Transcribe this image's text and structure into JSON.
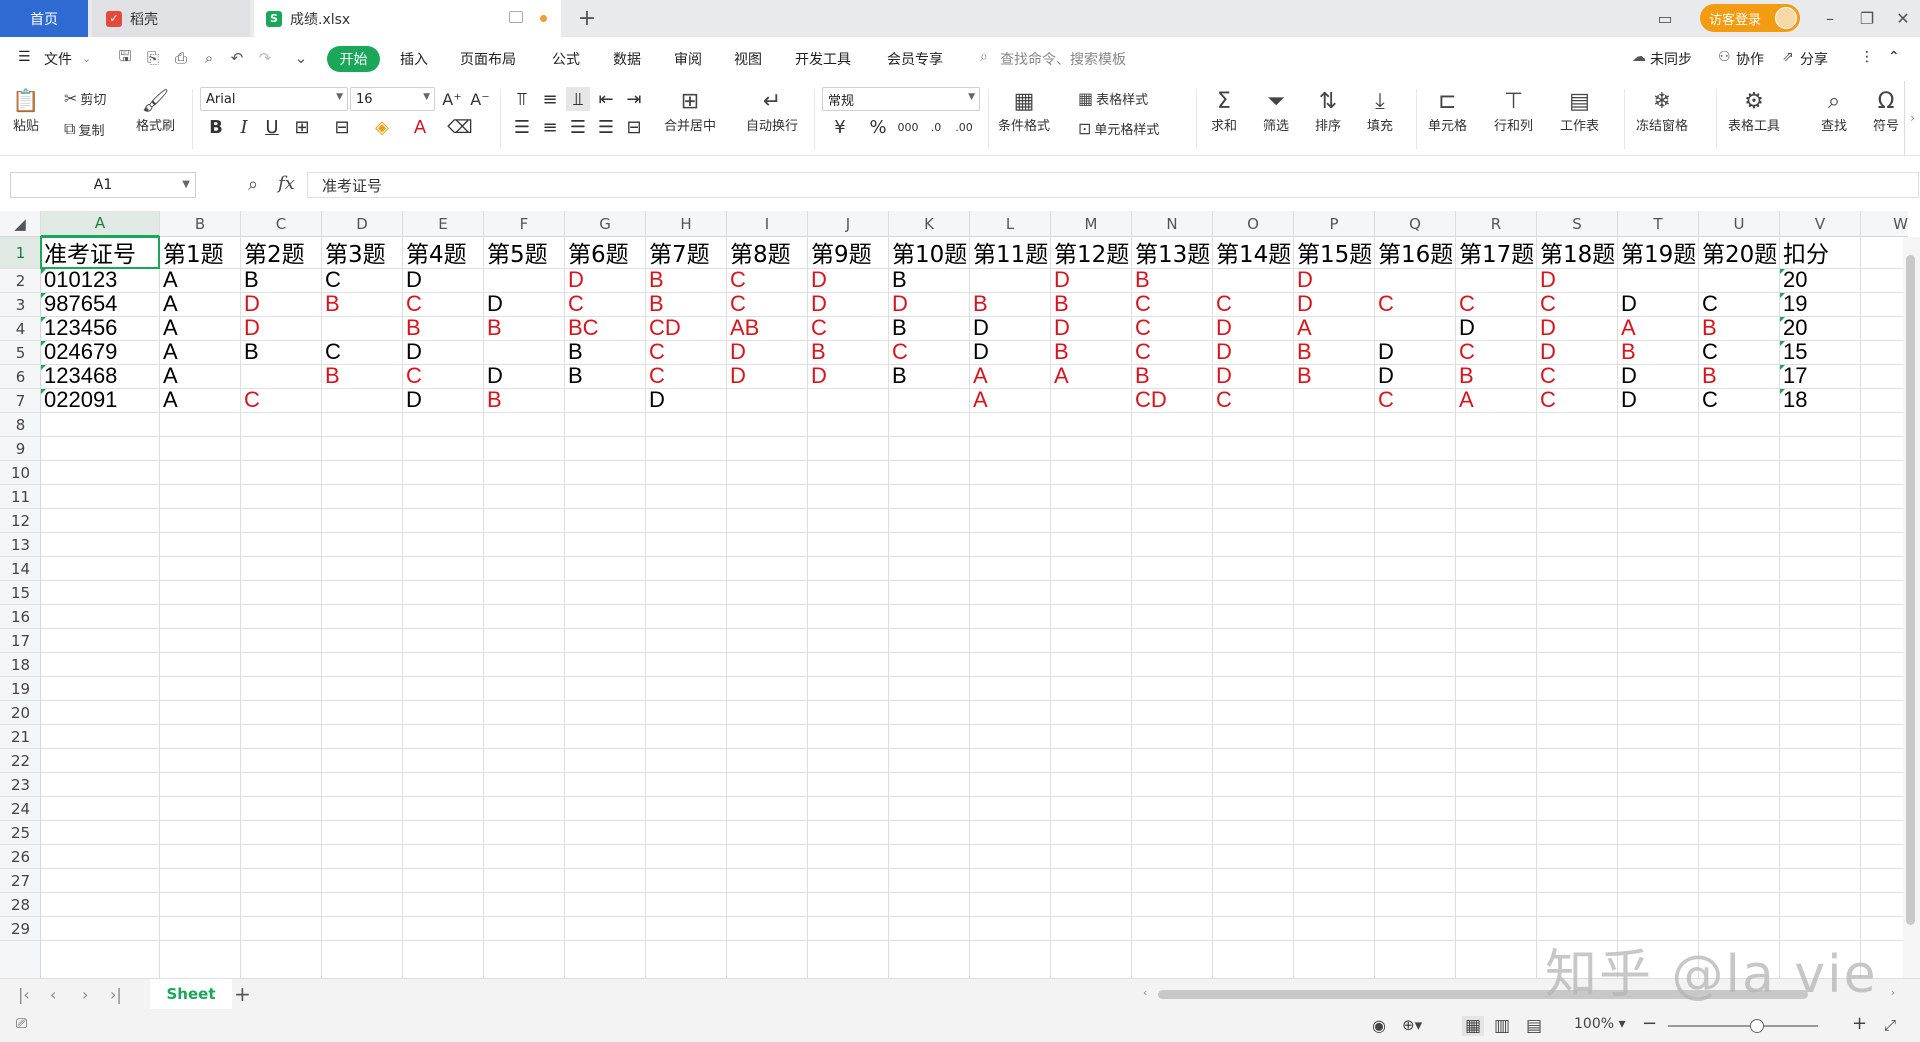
{
  "titlebar": {
    "home_tab": "首页",
    "dao_tab": "稻壳",
    "file_tab": "成绩.xlsx",
    "add_tab": "+",
    "visitor_login": "访客登录"
  },
  "menubar": {
    "file": "文件",
    "items": [
      "开始",
      "插入",
      "页面布局",
      "公式",
      "数据",
      "审阅",
      "视图",
      "开发工具",
      "会员专享"
    ],
    "search_placeholder": "查找命令、搜索模板",
    "unsynced": "未同步",
    "collaborate": "协作",
    "share": "分享"
  },
  "ribbon": {
    "paste": "粘贴",
    "cut": "剪切",
    "copy": "复制",
    "format_painter": "格式刷",
    "font_name": "Arial",
    "font_size": "16",
    "merge_center": "合并居中",
    "wrap_text": "自动换行",
    "number_format": "常规",
    "conditional_format": "条件格式",
    "table_style": "表格样式",
    "cell_style": "单元格样式",
    "sum": "求和",
    "filter": "筛选",
    "sort": "排序",
    "fill": "填充",
    "cell": "单元格",
    "row_col": "行和列",
    "worksheet": "工作表",
    "freeze": "冻结窗格",
    "table_tools": "表格工具",
    "find": "查找",
    "symbol": "符号"
  },
  "formulabar": {
    "namebox": "A1",
    "fx": "fx",
    "content": "准考证号"
  },
  "sheet": {
    "columns": [
      "A",
      "B",
      "C",
      "D",
      "E",
      "F",
      "G",
      "H",
      "I",
      "J",
      "K",
      "L",
      "M",
      "N",
      "O",
      "P",
      "Q",
      "R",
      "S",
      "T",
      "U",
      "V",
      "W"
    ],
    "rows": [
      "1",
      "2",
      "3",
      "4",
      "5",
      "6",
      "7",
      "8",
      "9",
      "10",
      "11",
      "12",
      "13",
      "14",
      "15",
      "16",
      "17",
      "18",
      "19",
      "20",
      "21",
      "22",
      "23",
      "24",
      "25",
      "26",
      "27",
      "28",
      "29"
    ],
    "header_row": [
      "准考证号",
      "第1题",
      "第2题",
      "第3题",
      "第4题",
      "第5题",
      "第6题",
      "第7题",
      "第8题",
      "第9题",
      "第10题",
      "第11题",
      "第12题",
      "第13题",
      "第14题",
      "第15题",
      "第16题",
      "第17题",
      "第18题",
      "第19题",
      "第20题",
      "扣分"
    ],
    "data": [
      {
        "id": "010123",
        "answers": [
          "A",
          "B",
          "C",
          "D",
          "",
          "D",
          "B",
          "C",
          "D",
          "B",
          "",
          "D",
          "B",
          "",
          "D",
          "",
          "",
          "D",
          "",
          "",
          ""
        ],
        "red": [
          false,
          false,
          false,
          false,
          false,
          true,
          true,
          true,
          true,
          false,
          false,
          true,
          true,
          false,
          true,
          false,
          false,
          true,
          false,
          false,
          false
        ],
        "score": "20"
      },
      {
        "id": "987654",
        "answers": [
          "A",
          "D",
          "B",
          "C",
          "D",
          "C",
          "B",
          "C",
          "D",
          "D",
          "B",
          "B",
          "C",
          "C",
          "D",
          "C",
          "C",
          "C",
          "D",
          "C",
          ""
        ],
        "red": [
          false,
          true,
          true,
          true,
          false,
          true,
          true,
          true,
          true,
          true,
          true,
          true,
          true,
          true,
          true,
          true,
          true,
          true,
          false,
          false,
          false
        ],
        "score": "19"
      },
      {
        "id": "123456",
        "answers": [
          "A",
          "D",
          "",
          "B",
          "B",
          "BC",
          "CD",
          "AB",
          "C",
          "B",
          "D",
          "D",
          "C",
          "D",
          "A",
          "",
          "D",
          "D",
          "A",
          "B",
          ""
        ],
        "red": [
          false,
          true,
          false,
          true,
          true,
          true,
          true,
          true,
          true,
          false,
          false,
          true,
          true,
          true,
          true,
          false,
          false,
          true,
          true,
          true,
          false
        ],
        "score": "20"
      },
      {
        "id": "024679",
        "answers": [
          "A",
          "B",
          "C",
          "D",
          "",
          "B",
          "C",
          "D",
          "B",
          "C",
          "D",
          "B",
          "C",
          "D",
          "B",
          "D",
          "C",
          "D",
          "B",
          "C",
          ""
        ],
        "red": [
          false,
          false,
          false,
          false,
          false,
          false,
          true,
          true,
          true,
          true,
          false,
          true,
          true,
          true,
          true,
          false,
          true,
          true,
          true,
          false,
          false
        ],
        "score": "15"
      },
      {
        "id": "123468",
        "answers": [
          "A",
          "",
          "B",
          "C",
          "D",
          "B",
          "C",
          "D",
          "D",
          "B",
          "A",
          "A",
          "B",
          "D",
          "B",
          "D",
          "B",
          "C",
          "D",
          "B",
          ""
        ],
        "red": [
          false,
          false,
          true,
          true,
          false,
          false,
          true,
          true,
          true,
          false,
          true,
          true,
          true,
          true,
          true,
          false,
          true,
          true,
          false,
          true,
          false
        ],
        "score": "17"
      },
      {
        "id": "022091",
        "answers": [
          "A",
          "C",
          "",
          "D",
          "B",
          "",
          "D",
          "",
          "",
          "",
          "A",
          "",
          "CD",
          "C",
          "",
          "C",
          "A",
          "C",
          "D",
          "C",
          ""
        ],
        "red": [
          false,
          true,
          false,
          false,
          true,
          false,
          false,
          false,
          false,
          false,
          true,
          false,
          true,
          true,
          false,
          true,
          true,
          true,
          false,
          false,
          false
        ],
        "score": "18"
      }
    ]
  },
  "sheetbar": {
    "sheet_name": "Sheet",
    "add": "+"
  },
  "statusbar": {
    "zoom": "100%"
  },
  "watermark": "知乎 @la vie",
  "colors": {
    "accent": "#1aa75a",
    "home_tab": "#2e6ad1",
    "error_text": "#d9141c",
    "visitor": "#f39c12"
  }
}
